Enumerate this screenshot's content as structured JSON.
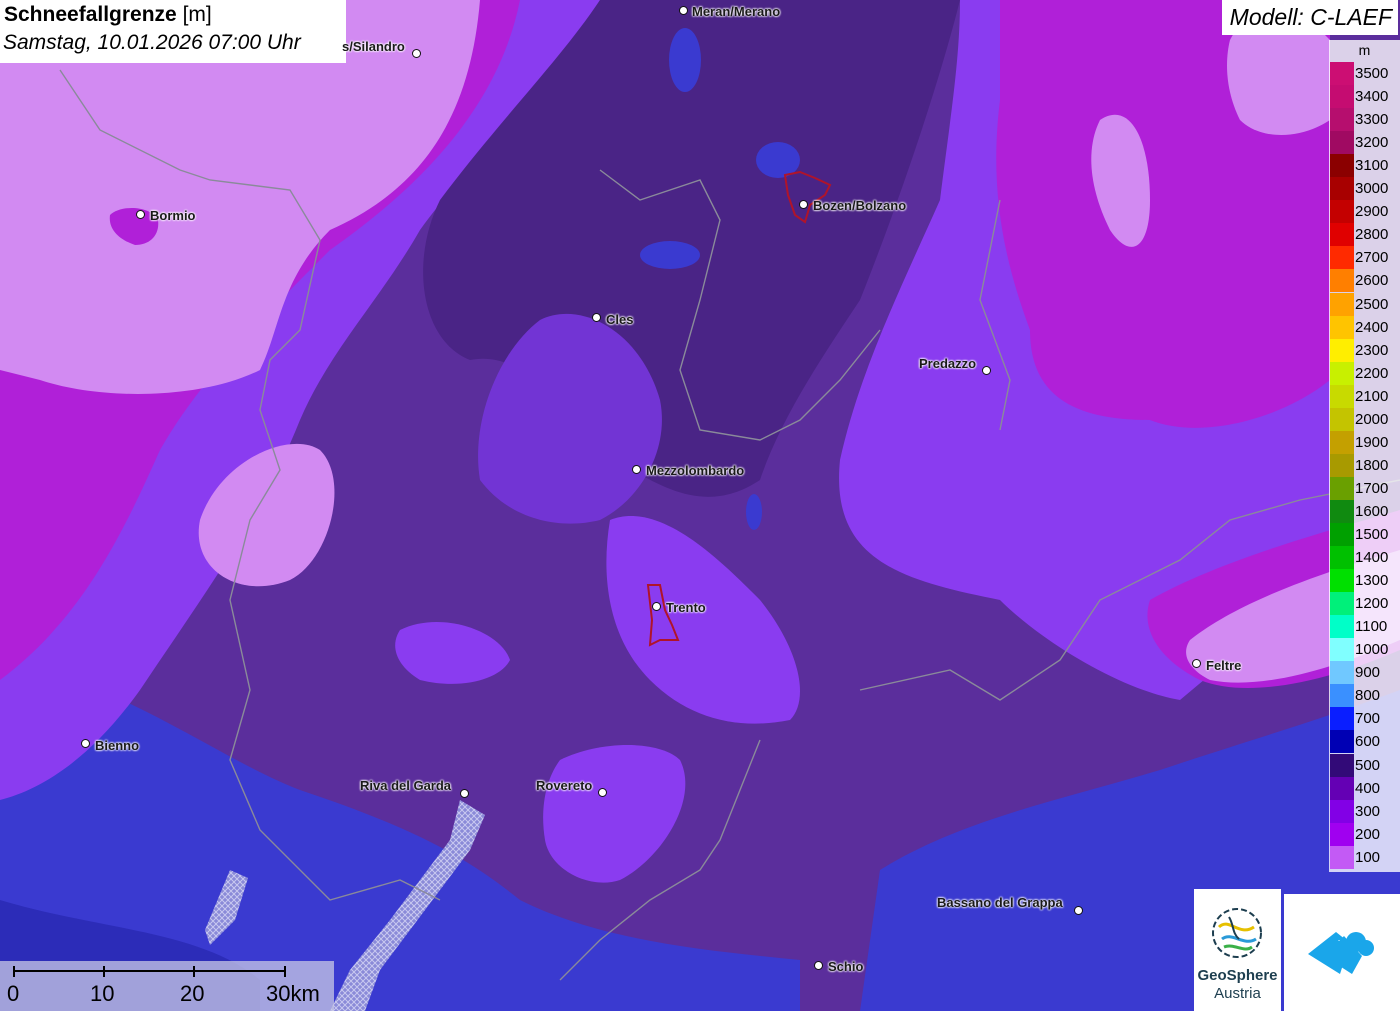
{
  "title": {
    "main": "Schneefallgrenze",
    "unit": "[m]",
    "datetime": "Samstag, 10.01.2026 07:00 Uhr"
  },
  "model": "Modell: C-LAEF",
  "legend": {
    "unit": "m",
    "entries": [
      {
        "label": "3500",
        "color": "#cc0e73"
      },
      {
        "label": "3400",
        "color": "#c50c71"
      },
      {
        "label": "3300",
        "color": "#b60e6e"
      },
      {
        "label": "3200",
        "color": "#a00a62"
      },
      {
        "label": "3100",
        "color": "#8b0000"
      },
      {
        "label": "3000",
        "color": "#a80000"
      },
      {
        "label": "2900",
        "color": "#c40000"
      },
      {
        "label": "2800",
        "color": "#e00000"
      },
      {
        "label": "2700",
        "color": "#ff2a00"
      },
      {
        "label": "2600",
        "color": "#ff7f00"
      },
      {
        "label": "2500",
        "color": "#ffa200"
      },
      {
        "label": "2400",
        "color": "#ffc400"
      },
      {
        "label": "2300",
        "color": "#ffee00"
      },
      {
        "label": "2200",
        "color": "#c8f000"
      },
      {
        "label": "2100",
        "color": "#c8da00"
      },
      {
        "label": "2000",
        "color": "#c4c400"
      },
      {
        "label": "1900",
        "color": "#c4a000"
      },
      {
        "label": "1800",
        "color": "#a89a00"
      },
      {
        "label": "1700",
        "color": "#6aa000"
      },
      {
        "label": "1600",
        "color": "#108a10"
      },
      {
        "label": "1500",
        "color": "#00a000"
      },
      {
        "label": "1400",
        "color": "#00c000"
      },
      {
        "label": "1300",
        "color": "#00e000"
      },
      {
        "label": "1200",
        "color": "#00f07a"
      },
      {
        "label": "1100",
        "color": "#00ffc8"
      },
      {
        "label": "1000",
        "color": "#80ffff"
      },
      {
        "label": "900",
        "color": "#70c8ff"
      },
      {
        "label": "800",
        "color": "#3a90ff"
      },
      {
        "label": "700",
        "color": "#0a1eff"
      },
      {
        "label": "600",
        "color": "#0000b4"
      },
      {
        "label": "500",
        "color": "#320a78"
      },
      {
        "label": "400",
        "color": "#6400b4"
      },
      {
        "label": "300",
        "color": "#8200e6"
      },
      {
        "label": "200",
        "color": "#a000f0"
      },
      {
        "label": "100",
        "color": "#c35af5"
      }
    ]
  },
  "cities": [
    {
      "name": "Meran/Merano"
    },
    {
      "name": "s/Silandro"
    },
    {
      "name": "Bormio"
    },
    {
      "name": "Bozen/Bolzano"
    },
    {
      "name": "Cles"
    },
    {
      "name": "Predazzo"
    },
    {
      "name": "Mezzolombardo"
    },
    {
      "name": "Trento"
    },
    {
      "name": "Feltre"
    },
    {
      "name": "Bienno"
    },
    {
      "name": "Riva del Garda"
    },
    {
      "name": "Rovereto"
    },
    {
      "name": "Bassano del Grappa"
    },
    {
      "name": "Schio"
    }
  ],
  "scale": {
    "labels": [
      "0",
      "10",
      "20",
      "30km"
    ]
  },
  "logos": {
    "geosphere_line1": "GeoSphere",
    "geosphere_line2": "Austria"
  }
}
